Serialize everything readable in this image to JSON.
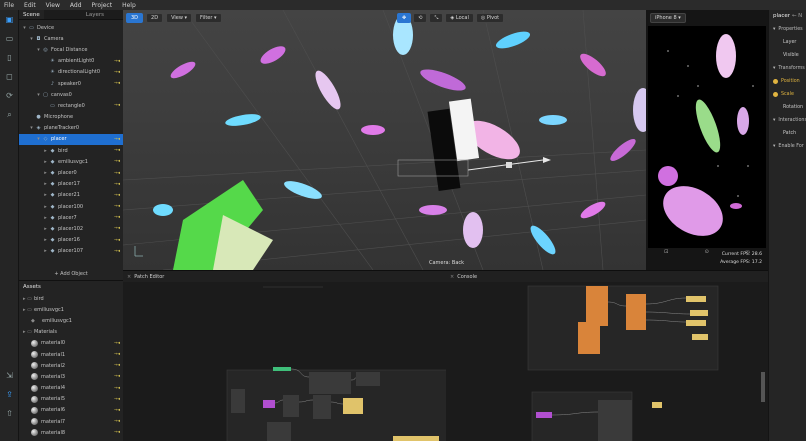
{
  "menu": [
    "File",
    "Edit",
    "View",
    "Add",
    "Project",
    "Help"
  ],
  "toolstrip": [
    "scene-tool",
    "camera-tool",
    "device-tool",
    "object-tool",
    "refresh-tool",
    "search-tool"
  ],
  "scene": {
    "tabs": [
      "Scene",
      "Layers"
    ],
    "tree": [
      {
        "label": "Device",
        "indent": 0,
        "glyph": "▾",
        "icon": "device"
      },
      {
        "label": "Camera",
        "indent": 1,
        "glyph": "▾",
        "icon": "camera"
      },
      {
        "label": "Focal Distance",
        "indent": 2,
        "glyph": "▾",
        "icon": "focal"
      },
      {
        "label": "ambientLight0",
        "indent": 3,
        "glyph": "",
        "icon": "light"
      },
      {
        "label": "directionalLight0",
        "indent": 3,
        "glyph": "",
        "icon": "light"
      },
      {
        "label": "speaker0",
        "indent": 3,
        "glyph": "",
        "icon": "speaker"
      },
      {
        "label": "canvas0",
        "indent": 2,
        "glyph": "▾",
        "icon": "canvas"
      },
      {
        "label": "rectangle0",
        "indent": 3,
        "glyph": "",
        "icon": "rect"
      },
      {
        "label": "Microphone",
        "indent": 1,
        "glyph": "",
        "icon": "mic"
      },
      {
        "label": "planeTracker0",
        "indent": 1,
        "glyph": "▾",
        "icon": "tracker"
      },
      {
        "label": "placer",
        "indent": 2,
        "glyph": "▾",
        "icon": "placer",
        "selected": true
      },
      {
        "label": "bird",
        "indent": 3,
        "glyph": "▸",
        "icon": "obj"
      },
      {
        "label": "emiliusvgc1",
        "indent": 3,
        "glyph": "▸",
        "icon": "obj"
      },
      {
        "label": "placer0",
        "indent": 3,
        "glyph": "▸",
        "icon": "obj"
      },
      {
        "label": "placer17",
        "indent": 3,
        "glyph": "▸",
        "icon": "obj"
      },
      {
        "label": "placer21",
        "indent": 3,
        "glyph": "▸",
        "icon": "obj"
      },
      {
        "label": "placer100",
        "indent": 3,
        "glyph": "▸",
        "icon": "obj"
      },
      {
        "label": "placer7",
        "indent": 3,
        "glyph": "▸",
        "icon": "obj"
      },
      {
        "label": "placer102",
        "indent": 3,
        "glyph": "▸",
        "icon": "obj"
      },
      {
        "label": "placer16",
        "indent": 3,
        "glyph": "▸",
        "icon": "obj"
      },
      {
        "label": "placer107",
        "indent": 3,
        "glyph": "▸",
        "icon": "obj"
      }
    ],
    "add_object": "+ Add Object"
  },
  "viewport": {
    "mode_3d": "3D",
    "mode_2d": "2D",
    "view_label": "View",
    "filter_label": "Filter",
    "local_label": "Local",
    "pivot_label": "Pivot",
    "camera_caption": "Camera: Back"
  },
  "phone": {
    "device": "iPhone 8",
    "fps_current": "Current FPS: 28.6",
    "fps_average": "Average FPS: 17.2"
  },
  "properties": {
    "title": "placer",
    "title_suffix": "← N",
    "rows": [
      {
        "label": "Properties",
        "kind": "sec"
      },
      {
        "label": "Layer",
        "kind": "row"
      },
      {
        "label": "Visible",
        "kind": "row"
      },
      {
        "label": "Transforms",
        "kind": "sec"
      },
      {
        "label": "Position",
        "kind": "gold"
      },
      {
        "label": "Scale",
        "kind": "gold"
      },
      {
        "label": "Rotation",
        "kind": "row"
      },
      {
        "label": "Interactions",
        "kind": "sec"
      },
      {
        "label": "Patch",
        "kind": "row"
      },
      {
        "label": "Enable For",
        "kind": "sec"
      }
    ]
  },
  "assets": {
    "title": "Assets",
    "items": [
      {
        "label": "bird",
        "indent": 0,
        "kind": "folder"
      },
      {
        "label": "emiliusvgc1",
        "indent": 0,
        "kind": "folder"
      },
      {
        "label": "emiliusvgc1",
        "indent": 1,
        "kind": "mesh"
      },
      {
        "label": "Materials",
        "indent": 0,
        "kind": "folder"
      },
      {
        "label": "material0",
        "indent": 1,
        "kind": "material"
      },
      {
        "label": "material1",
        "indent": 1,
        "kind": "material"
      },
      {
        "label": "material2",
        "indent": 1,
        "kind": "material"
      },
      {
        "label": "material3",
        "indent": 1,
        "kind": "material"
      },
      {
        "label": "material4",
        "indent": 1,
        "kind": "material"
      },
      {
        "label": "material5",
        "indent": 1,
        "kind": "material"
      },
      {
        "label": "material6",
        "indent": 1,
        "kind": "material"
      },
      {
        "label": "material7",
        "indent": 1,
        "kind": "material"
      },
      {
        "label": "material8",
        "indent": 1,
        "kind": "material"
      }
    ]
  },
  "patch_editor": {
    "title": "Patch Editor"
  },
  "console": {
    "title": "Console"
  },
  "colors": {
    "accent": "#1f6fd1",
    "selection": "#1f6fd1",
    "patch_orange": "#d9843a",
    "patch_yellow": "#e0c36a",
    "patch_purple": "#b14fd0",
    "patch_green": "#3fbf7a"
  }
}
